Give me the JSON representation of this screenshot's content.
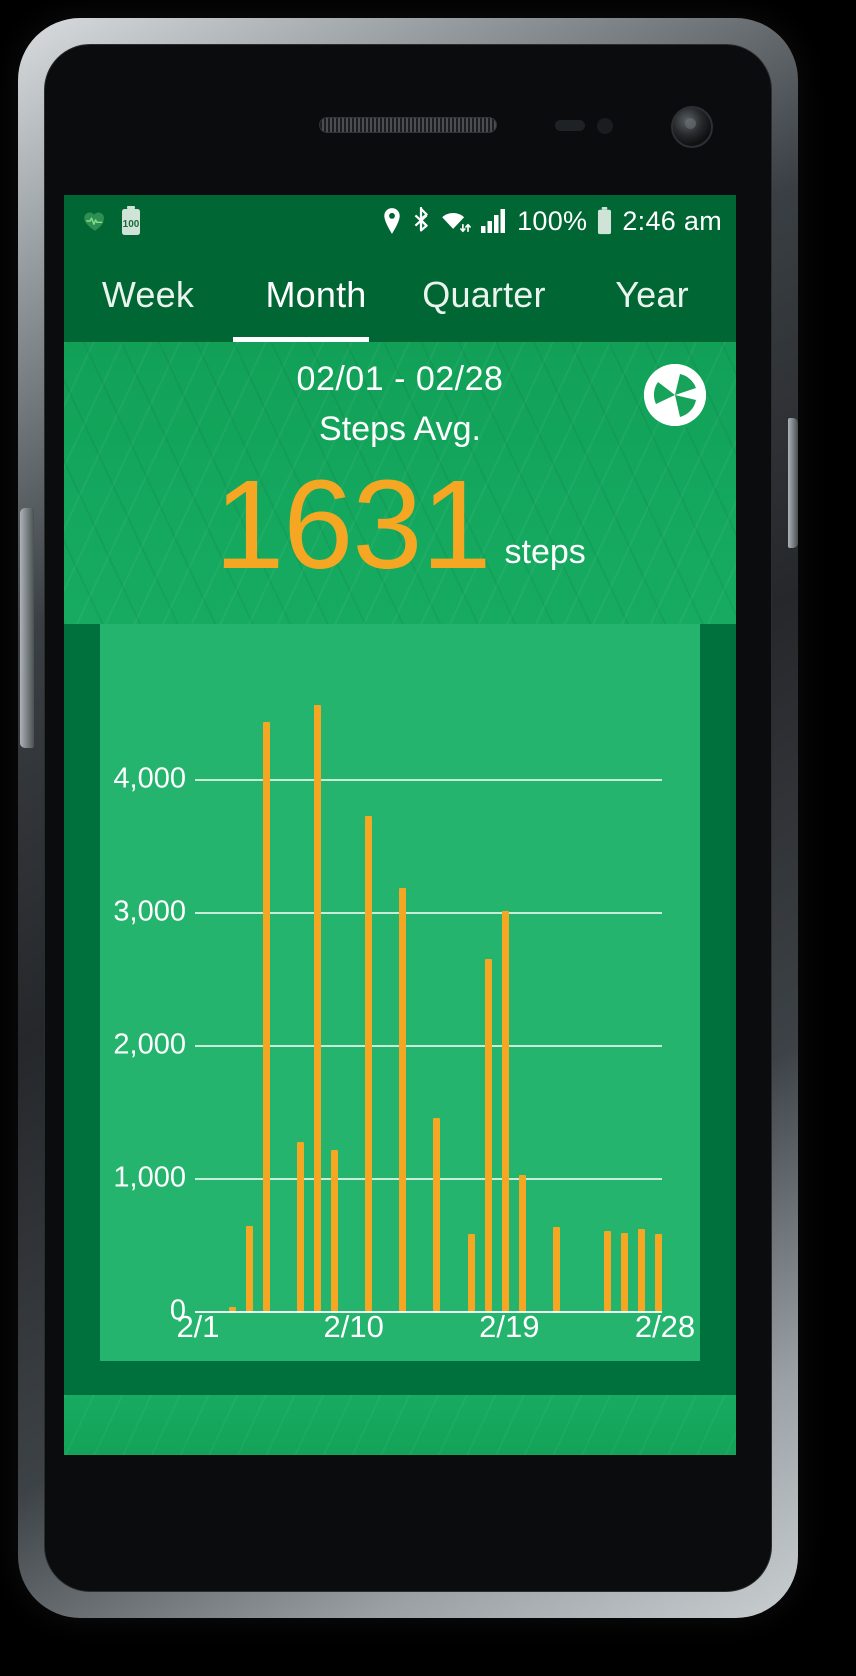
{
  "device": {
    "frame_name": "android-phone",
    "speaker_icon": "speaker-grille",
    "camera_icon": "front-camera"
  },
  "status_bar": {
    "left_icons": [
      {
        "name": "heart-rate-icon",
        "glyph": "heart"
      },
      {
        "name": "battery-saver-icon",
        "glyph": "battery",
        "label": "100"
      }
    ],
    "right_icons": [
      {
        "name": "location-pin-icon"
      },
      {
        "name": "bluetooth-icon"
      },
      {
        "name": "wifi-icon"
      },
      {
        "name": "signal-bars-icon"
      }
    ],
    "battery_percent": "100%",
    "time": "2:46 am"
  },
  "tabs": {
    "items": [
      {
        "label": "Week",
        "active": false
      },
      {
        "label": "Month",
        "active": true
      },
      {
        "label": "Quarter",
        "active": false
      },
      {
        "label": "Year",
        "active": false
      }
    ],
    "active_index": 1
  },
  "hero": {
    "date_range": "02/01 - 02/28",
    "metric_label": "Steps Avg.",
    "value": "1631",
    "unit": "steps",
    "logo_name": "app-logo-pinwheel",
    "accent_color": "#f5a623",
    "background_color": "#1aa55c"
  },
  "chart_data": {
    "type": "bar",
    "title": "Steps Avg.",
    "subtitle": "02/01 - 02/28",
    "xlabel": "",
    "ylabel": "",
    "ylim": [
      0,
      4850
    ],
    "yticks": [
      0,
      1000,
      2000,
      3000,
      4000
    ],
    "ytick_labels": [
      "0",
      "1,000",
      "2,000",
      "3,000",
      "4,000"
    ],
    "grid": true,
    "legend": "none",
    "bar_color": "#f5a623",
    "plot_background": "#24b46e",
    "categories": [
      "2/1",
      "2/2",
      "2/3",
      "2/4",
      "2/5",
      "2/6",
      "2/7",
      "2/8",
      "2/9",
      "2/10",
      "2/11",
      "2/12",
      "2/13",
      "2/14",
      "2/15",
      "2/16",
      "2/17",
      "2/18",
      "2/19",
      "2/20",
      "2/21",
      "2/22",
      "2/23",
      "2/24",
      "2/25",
      "2/26",
      "2/27",
      "2/28"
    ],
    "xtick_labels": [
      "2/1",
      "2/10",
      "2/19",
      "2/28"
    ],
    "xtick_indices": [
      0,
      9,
      18,
      27
    ],
    "values": [
      0,
      0,
      30,
      640,
      4430,
      0,
      1270,
      4560,
      1210,
      0,
      3720,
      0,
      3180,
      0,
      1450,
      0,
      580,
      2650,
      3010,
      1020,
      0,
      630,
      0,
      0,
      600,
      590,
      620,
      580
    ],
    "average": 1631
  }
}
